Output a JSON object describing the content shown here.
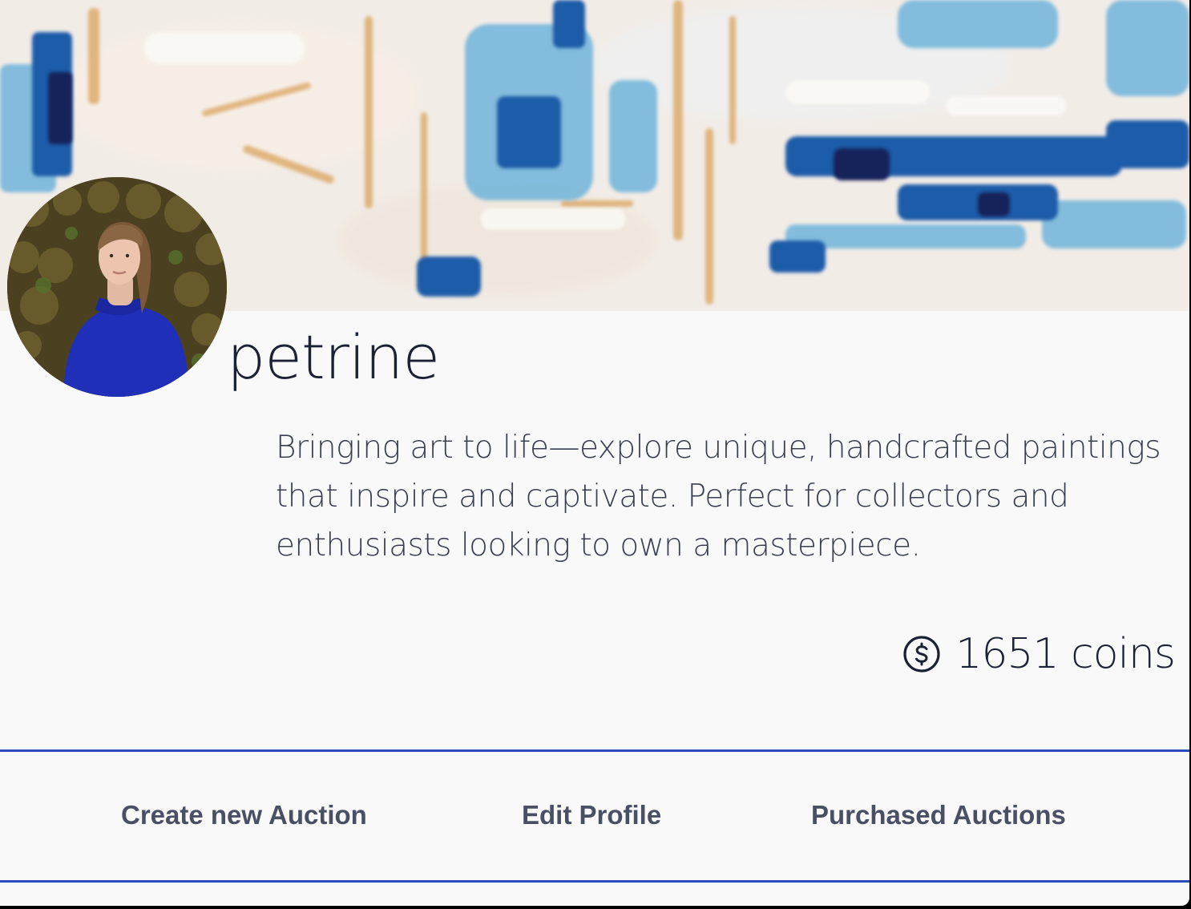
{
  "profile": {
    "username": "petrine",
    "bio": "Bringing art to life—explore unique, handcrafted paintings that inspire and captivate. Perfect for collectors and enthusiasts looking to own a masterpiece.",
    "coins_label": "1651 coins"
  },
  "nav": {
    "create_label": "Create new Auction",
    "edit_label": "Edit Profile",
    "purchased_label": "Purchased Auctions"
  },
  "icons": {
    "coin": "dollar-circle-icon"
  },
  "colors": {
    "accent": "#2d4bbc",
    "text_dark": "#1c2134",
    "text_muted": "#4a5064",
    "background": "#f9f9fa"
  }
}
